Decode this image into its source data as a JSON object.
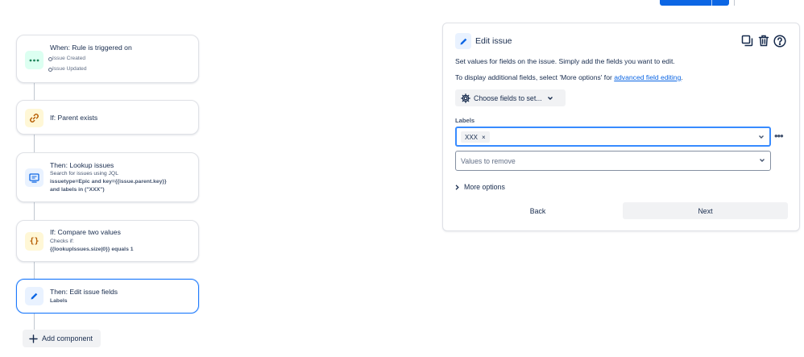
{
  "colors": {
    "accent": "#0c66e4",
    "active_border": "#1d7afc",
    "green_icon_bg": "#dcfff1",
    "yellow_icon_bg": "#fff7d6",
    "blue_icon_bg": "#e9f2ff"
  },
  "flow": {
    "trigger": {
      "title": "When: Rule is triggered on",
      "events": [
        "Issue Created",
        "Issue Updated"
      ],
      "icon": "ellipsis-icon"
    },
    "condition": {
      "title": "If: Parent exists",
      "icon": "link-icon"
    },
    "lookup": {
      "title": "Then: Lookup issues",
      "desc": "Search for issues using JQL",
      "jql_line1": "issuetype=Epic and key={{issue.parent.key}}",
      "jql_line2": "and labels in (\"XXX\")",
      "icon": "monitor-icon"
    },
    "compare": {
      "title": "If: Compare two values",
      "desc": "Checks if:",
      "expr": "{{lookupIssues.size|0}} equals 1",
      "icon": "braces-icon"
    },
    "edit": {
      "title": "Then: Edit issue fields",
      "desc": "Labels",
      "icon": "pencil-icon"
    },
    "add_component": "Add component"
  },
  "panel": {
    "title": "Edit issue",
    "intro": "Set values for fields on the issue. Simply add the fields you want to edit.",
    "additional_prefix": "To display additional fields, select 'More options' for ",
    "additional_link": "advanced field editing",
    "additional_suffix": ".",
    "choose_fields": "Choose fields to set...",
    "labels_label": "Labels",
    "label_tag": "XXX",
    "remove_placeholder": "Values to remove",
    "more_options": "More options",
    "back": "Back",
    "next": "Next"
  }
}
